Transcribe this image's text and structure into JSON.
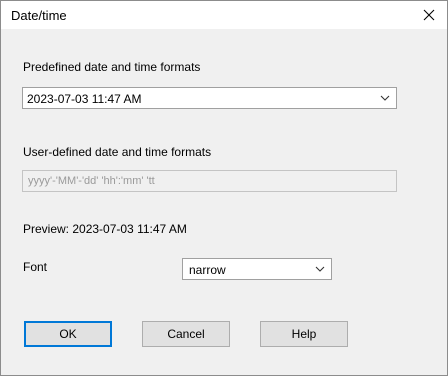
{
  "window": {
    "title": "Date/time",
    "close_glyph": "✕"
  },
  "predefined": {
    "label": "Predefined date and time formats",
    "selected": "2023-07-03 11:47 AM"
  },
  "user_defined": {
    "label": "User-defined date and time formats",
    "value": "yyyy'-'MM'-'dd' 'hh':'mm' 'tt",
    "enabled": false
  },
  "preview": {
    "text": "Preview: 2023-07-03 11:47 AM"
  },
  "font": {
    "label": "Font",
    "selected": "narrow"
  },
  "buttons": {
    "ok": "OK",
    "cancel": "Cancel",
    "help": "Help"
  },
  "colors": {
    "dialog_background": "#f0f0f0",
    "default_button_border": "#0078d7",
    "button_face": "#e1e1e1"
  },
  "icons": {
    "close": "close-icon",
    "dropdown": "chevron-down-icon"
  }
}
